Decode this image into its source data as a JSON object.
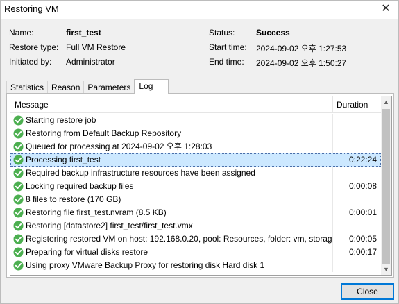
{
  "window": {
    "title": "Restoring VM",
    "close_glyph": "✕"
  },
  "info": {
    "name_label": "Name:",
    "name_value": "first_test",
    "restore_type_label": "Restore type:",
    "restore_type_value": "Full VM Restore",
    "initiated_label": "Initiated by:",
    "initiated_value": "Administrator",
    "status_label": "Status:",
    "status_value": "Success",
    "start_label": "Start time:",
    "start_value": "2024-09-02 오후 1:27:53",
    "end_label": "End time:",
    "end_value": "2024-09-02 오후 1:50:27"
  },
  "tabs": [
    "Statistics",
    "Reason",
    "Parameters",
    "Log"
  ],
  "active_tab": "Log",
  "log": {
    "columns": {
      "message": "Message",
      "duration": "Duration"
    },
    "rows": [
      {
        "message": "Starting restore job",
        "duration": "",
        "status": "success"
      },
      {
        "message": "Restoring from Default Backup Repository",
        "duration": "",
        "status": "success"
      },
      {
        "message": "Queued for processing at 2024-09-02 오후 1:28:03",
        "duration": "",
        "status": "success"
      },
      {
        "message": "Processing first_test",
        "duration": "0:22:24",
        "status": "success",
        "selected": true
      },
      {
        "message": "Required backup infrastructure resources have been assigned",
        "duration": "",
        "status": "success"
      },
      {
        "message": "Locking required backup files",
        "duration": "0:00:08",
        "status": "success"
      },
      {
        "message": "8 files to restore (170 GB)",
        "duration": "",
        "status": "success"
      },
      {
        "message": "Restoring file first_test.nvram (8.5 KB)",
        "duration": "0:00:01",
        "status": "success"
      },
      {
        "message": "Restoring [datastore2] first_test/first_test.vmx",
        "duration": "",
        "status": "success"
      },
      {
        "message": "Registering restored VM on host: 192.168.0.20, pool: Resources, folder: vm, storag...",
        "duration": "0:00:05",
        "status": "success"
      },
      {
        "message": "Preparing for virtual disks restore",
        "duration": "0:00:17",
        "status": "success"
      },
      {
        "message": "Using proxy VMware Backup Proxy for restoring disk Hard disk 1",
        "duration": "",
        "status": "success"
      }
    ]
  },
  "buttons": {
    "close": "Close"
  },
  "colors": {
    "success": "#4caf50",
    "selection": "#cce8ff",
    "accent": "#0078d7"
  },
  "icons": {
    "status": "check-circle-icon",
    "scroll_up": "▲",
    "scroll_down": "▼"
  }
}
